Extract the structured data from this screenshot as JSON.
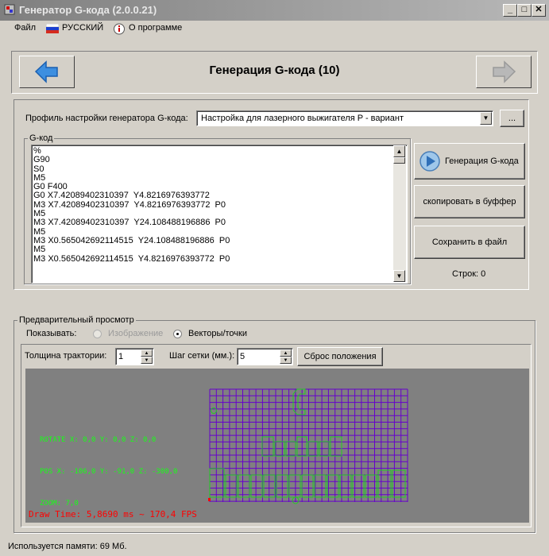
{
  "window": {
    "title": "Генератор G-кода (2.0.0.21)"
  },
  "menu": {
    "file": "Файл",
    "language": "РУССКИЙ",
    "about": "О программе"
  },
  "header": {
    "title": "Генерация G-кода (10)"
  },
  "profile": {
    "label": "Профиль настройки генератора G-кода:",
    "value": "Настройка для лазерного выжигателя P - вариант",
    "more_button": "..."
  },
  "gcode": {
    "legend": "G-код",
    "lines": [
      "%",
      "G90",
      "S0",
      "M5",
      "G0 F400",
      "G0 X7.42089402310397  Y4.8216976393772",
      "M3 X7.42089402310397  Y4.8216976393772  P0",
      "M5",
      "M3 X7.42089402310397  Y24.108488196886  P0",
      "M5",
      "M3 X0.565042692114515  Y24.108488196886  P0",
      "M5",
      "M3 X0.565042692114515  Y4.8216976393772  P0"
    ],
    "generate_button": "Генерация G-кода",
    "copy_button": "скопировать в буффер",
    "save_button": "Сохранить в файл",
    "lines_count": "Строк: 0"
  },
  "preview": {
    "legend": "Предварительный просмотр",
    "show_label": "Показывать:",
    "option_image": "Изображение",
    "option_vectors": "Векторы/точки",
    "selected_option": "Векторы/точки",
    "thickness_label": "Толщина трактории:",
    "thickness_value": "1",
    "grid_label": "Шаг сетки (мм.):",
    "grid_value": "5",
    "reset_button": "Сброс положения",
    "overlay": {
      "rotate": "ROTATE X: 0,0  Y: 0,0 Z: 0,0",
      "pos": "POS X: -106,0  Y: -91,0 Z: -300,0",
      "zoom": "ZOOM: 7,0",
      "draw_time": "Draw Time: 5,8690 ms ~ 170,4 FPS"
    }
  },
  "status": {
    "memory": "Используется памяти:  69  Мб."
  },
  "colors": {
    "window_bg": "#d4d0c8",
    "grid": "#6600cc",
    "vector_outline": "#22cc22",
    "overlay_text": "#15ff15",
    "draw_time_text": "#ff0000",
    "viewport_bg": "#808080"
  },
  "icons": {
    "back": "arrow-left-icon",
    "forward": "arrow-right-icon",
    "generate": "play-circle-icon",
    "language": "russian-flag-icon",
    "about": "info-icon"
  }
}
